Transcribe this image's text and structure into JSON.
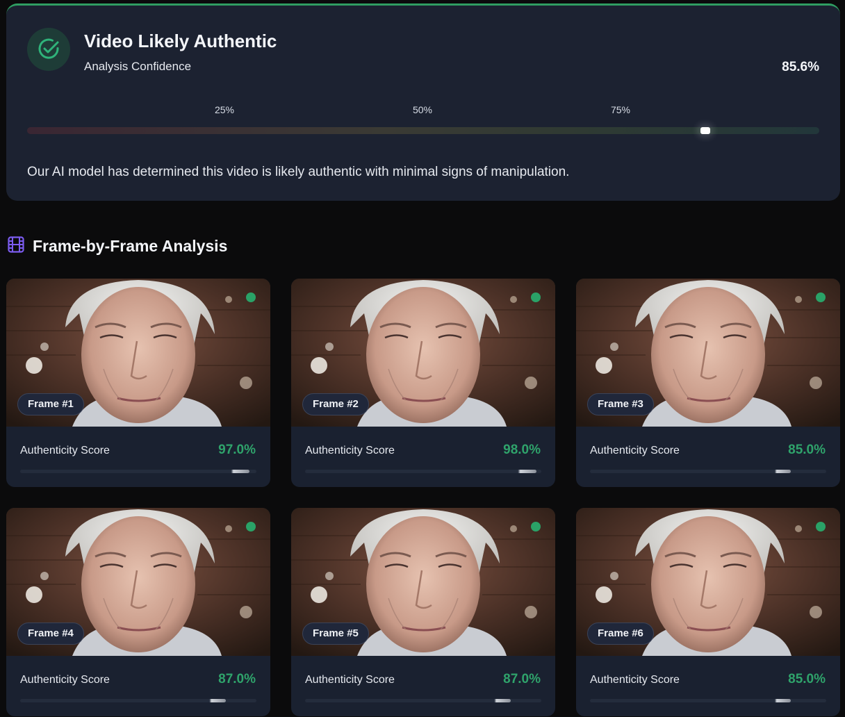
{
  "result": {
    "title": "Video Likely Authentic",
    "subtitle": "Analysis Confidence",
    "confidence": "85.6%",
    "confidence_fraction": 0.856,
    "ticks": [
      "25%",
      "50%",
      "75%"
    ],
    "summary": "Our AI model has determined this video is likely authentic with minimal signs of manipulation.",
    "status_icon": "check-circle-icon",
    "accent_color": "#2f9e62"
  },
  "section": {
    "title": "Frame-by-Frame Analysis",
    "icon": "film-icon",
    "icon_color": "#7c5cf0"
  },
  "frames": [
    {
      "label": "Frame #1",
      "score_label": "Authenticity Score",
      "score": "97.0%",
      "fraction": 0.97
    },
    {
      "label": "Frame #2",
      "score_label": "Authenticity Score",
      "score": "98.0%",
      "fraction": 0.98
    },
    {
      "label": "Frame #3",
      "score_label": "Authenticity Score",
      "score": "85.0%",
      "fraction": 0.85
    },
    {
      "label": "Frame #4",
      "score_label": "Authenticity Score",
      "score": "87.0%",
      "fraction": 0.87
    },
    {
      "label": "Frame #5",
      "score_label": "Authenticity Score",
      "score": "87.0%",
      "fraction": 0.87
    },
    {
      "label": "Frame #6",
      "score_label": "Authenticity Score",
      "score": "85.0%",
      "fraction": 0.85
    }
  ],
  "colors": {
    "score_good": "#2fa36b",
    "status_dot": "#2aa267"
  }
}
